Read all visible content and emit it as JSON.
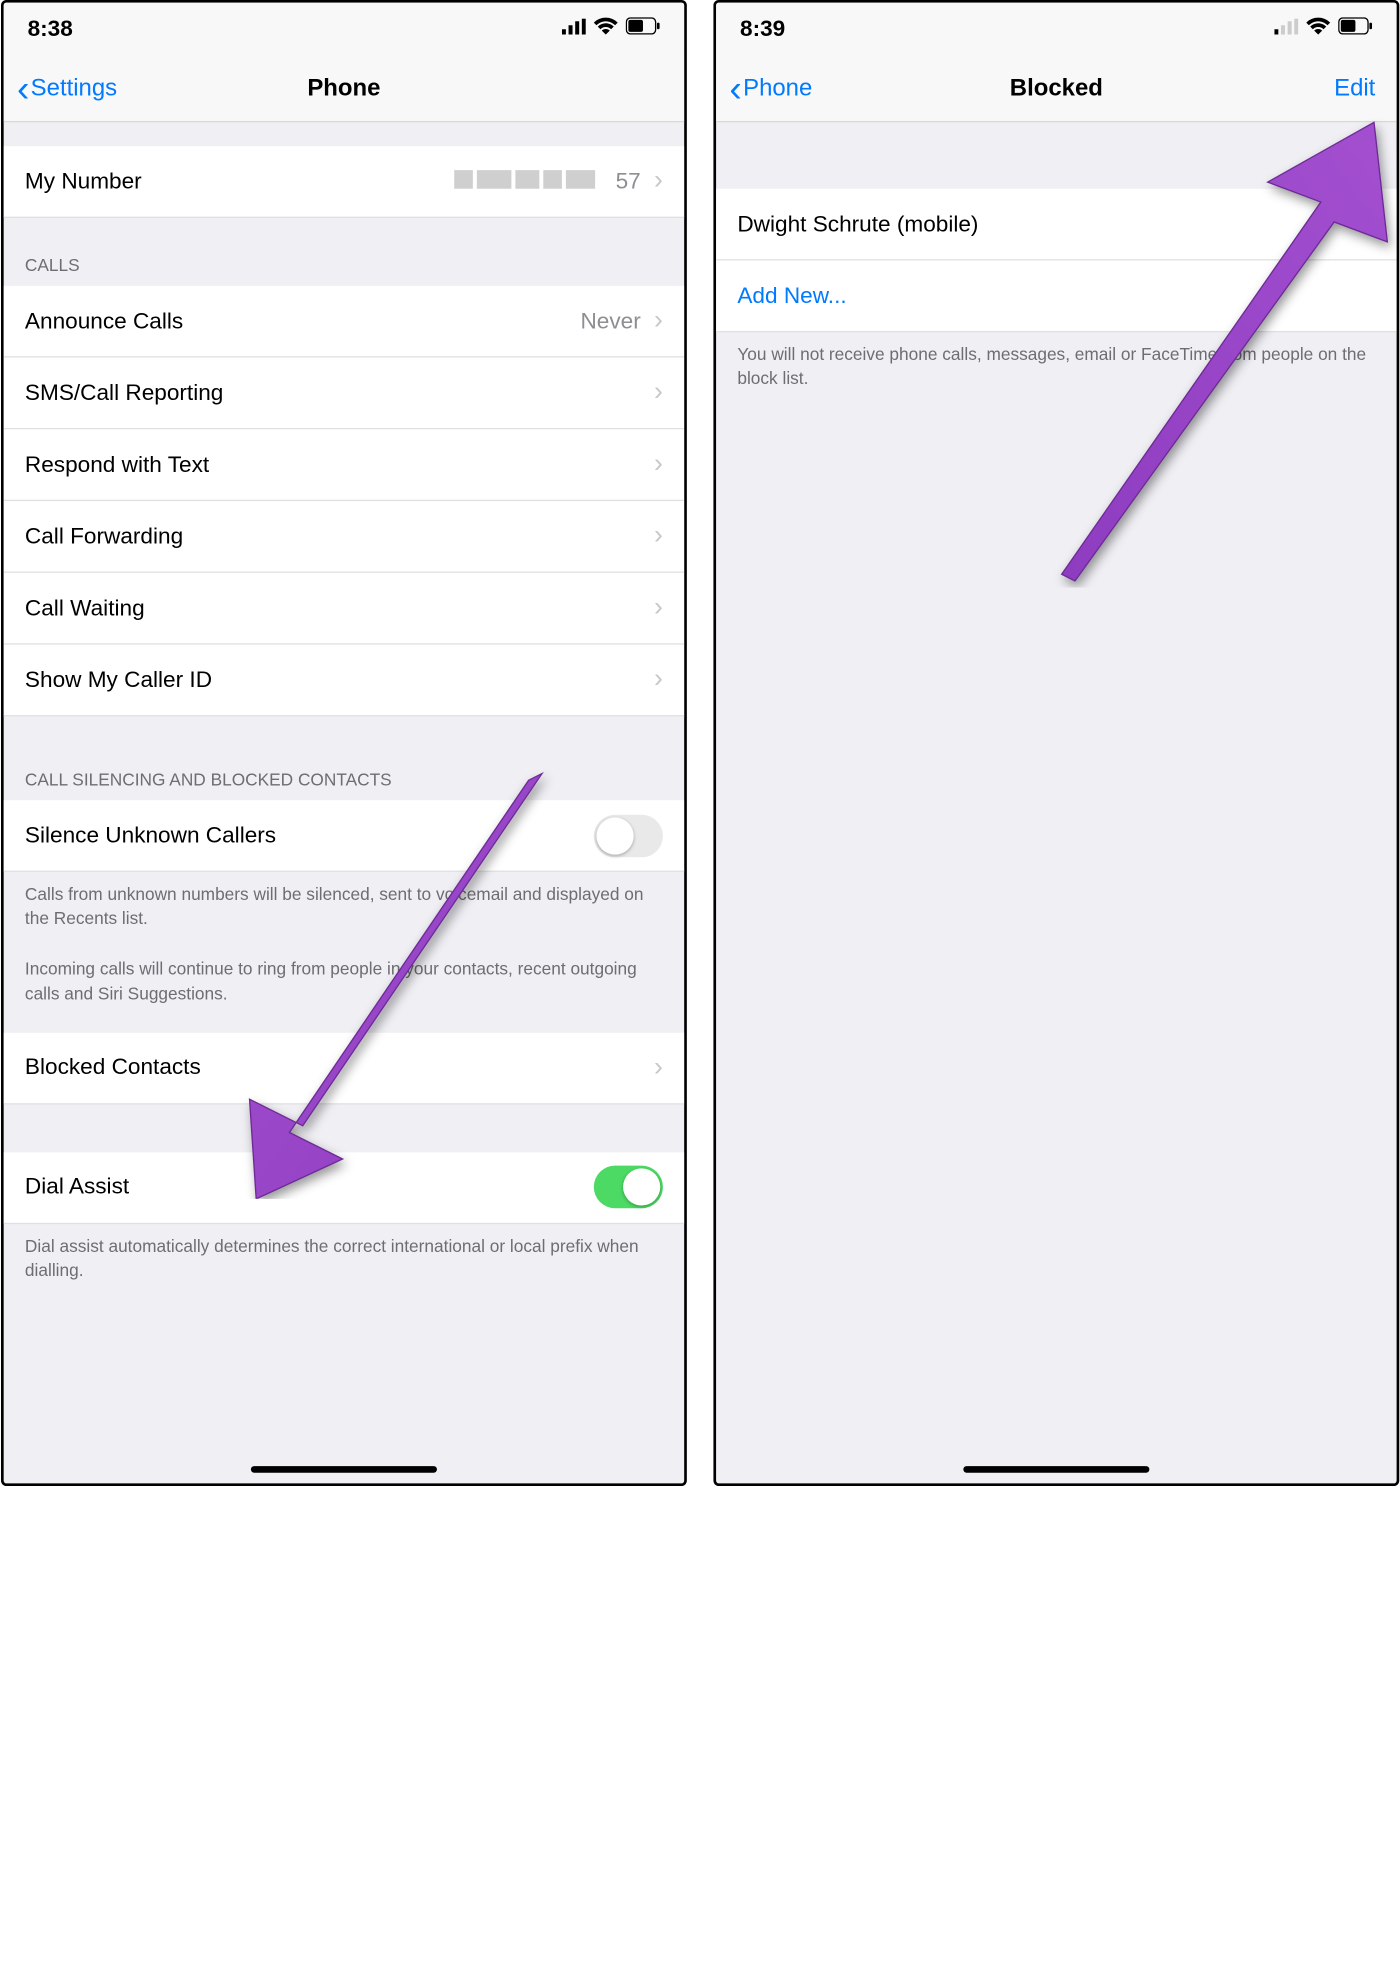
{
  "left": {
    "status": {
      "time": "8:38"
    },
    "nav": {
      "back": "Settings",
      "title": "Phone"
    },
    "my_number": {
      "label": "My Number",
      "value_suffix": "57"
    },
    "sections": {
      "calls_header": "CALLS",
      "announce": {
        "label": "Announce Calls",
        "value": "Never"
      },
      "sms": {
        "label": "SMS/Call Reporting"
      },
      "respond": {
        "label": "Respond with Text"
      },
      "forwarding": {
        "label": "Call Forwarding"
      },
      "waiting": {
        "label": "Call Waiting"
      },
      "caller_id": {
        "label": "Show My Caller ID"
      },
      "silencing_header": "CALL SILENCING AND BLOCKED CONTACTS",
      "silence_unknown": {
        "label": "Silence Unknown Callers"
      },
      "silence_footer1": "Calls from unknown numbers will be silenced, sent to voicemail and displayed on the Recents list.",
      "silence_footer2": "Incoming calls will continue to ring from people in your contacts, recent outgoing calls and Siri Suggestions.",
      "blocked": {
        "label": "Blocked Contacts"
      },
      "dial_assist": {
        "label": "Dial Assist"
      },
      "dial_footer": "Dial assist automatically determines the correct international or local prefix when dialling."
    }
  },
  "right": {
    "status": {
      "time": "8:39"
    },
    "nav": {
      "back": "Phone",
      "title": "Blocked",
      "edit": "Edit"
    },
    "entries": {
      "0": {
        "label": "Dwight Schrute (mobile)"
      }
    },
    "add_new": "Add New...",
    "footer": "You will not receive phone calls, messages, email or FaceTime from people on the block list."
  }
}
